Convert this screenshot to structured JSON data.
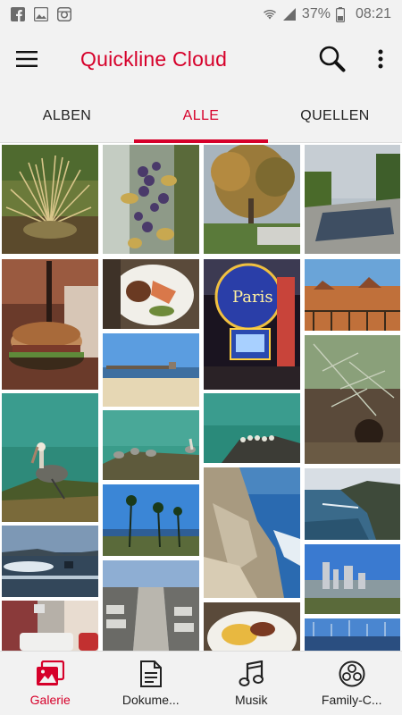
{
  "status_bar": {
    "left_icons": [
      "facebook-icon",
      "gallery-icon",
      "instagram-icon"
    ],
    "battery": "37%",
    "time": "08:21"
  },
  "app_bar": {
    "title": "Quickline Cloud",
    "title_color": "#d6002a"
  },
  "tabs": [
    {
      "label": "ALBEN",
      "active": false
    },
    {
      "label": "ALLE",
      "active": true
    },
    {
      "label": "QUELLEN",
      "active": false
    }
  ],
  "gallery": {
    "photos": [
      {
        "name": "photo-grass-plant"
      },
      {
        "name": "photo-grape-vine"
      },
      {
        "name": "photo-autumn-tree"
      },
      {
        "name": "photo-empty-pool"
      },
      {
        "name": "photo-burger"
      },
      {
        "name": "photo-dinner-plate"
      },
      {
        "name": "photo-paris-las-vegas-sign"
      },
      {
        "name": "photo-desert-landscape"
      },
      {
        "name": "photo-beach-pier"
      },
      {
        "name": "photo-pelican"
      },
      {
        "name": "photo-pelicans-rocks"
      },
      {
        "name": "photo-sea-lions-rock"
      },
      {
        "name": "photo-pine-branch"
      },
      {
        "name": "photo-palm-trees-coast"
      },
      {
        "name": "photo-cliff-rocks"
      },
      {
        "name": "photo-coastline"
      },
      {
        "name": "photo-ocean-sunset"
      },
      {
        "name": "photo-city-view"
      },
      {
        "name": "photo-parked-cars-street"
      },
      {
        "name": "photo-street-taxi"
      },
      {
        "name": "photo-breakfast-plate"
      },
      {
        "name": "photo-harbor-boats"
      }
    ]
  },
  "bottom_nav": [
    {
      "label": "Galerie",
      "icon": "gallery-icon",
      "active": true
    },
    {
      "label": "Dokume...",
      "icon": "document-icon",
      "active": false
    },
    {
      "label": "Musik",
      "icon": "music-icon",
      "active": false
    },
    {
      "label": "Family-C...",
      "icon": "family-icon",
      "active": false
    }
  ]
}
